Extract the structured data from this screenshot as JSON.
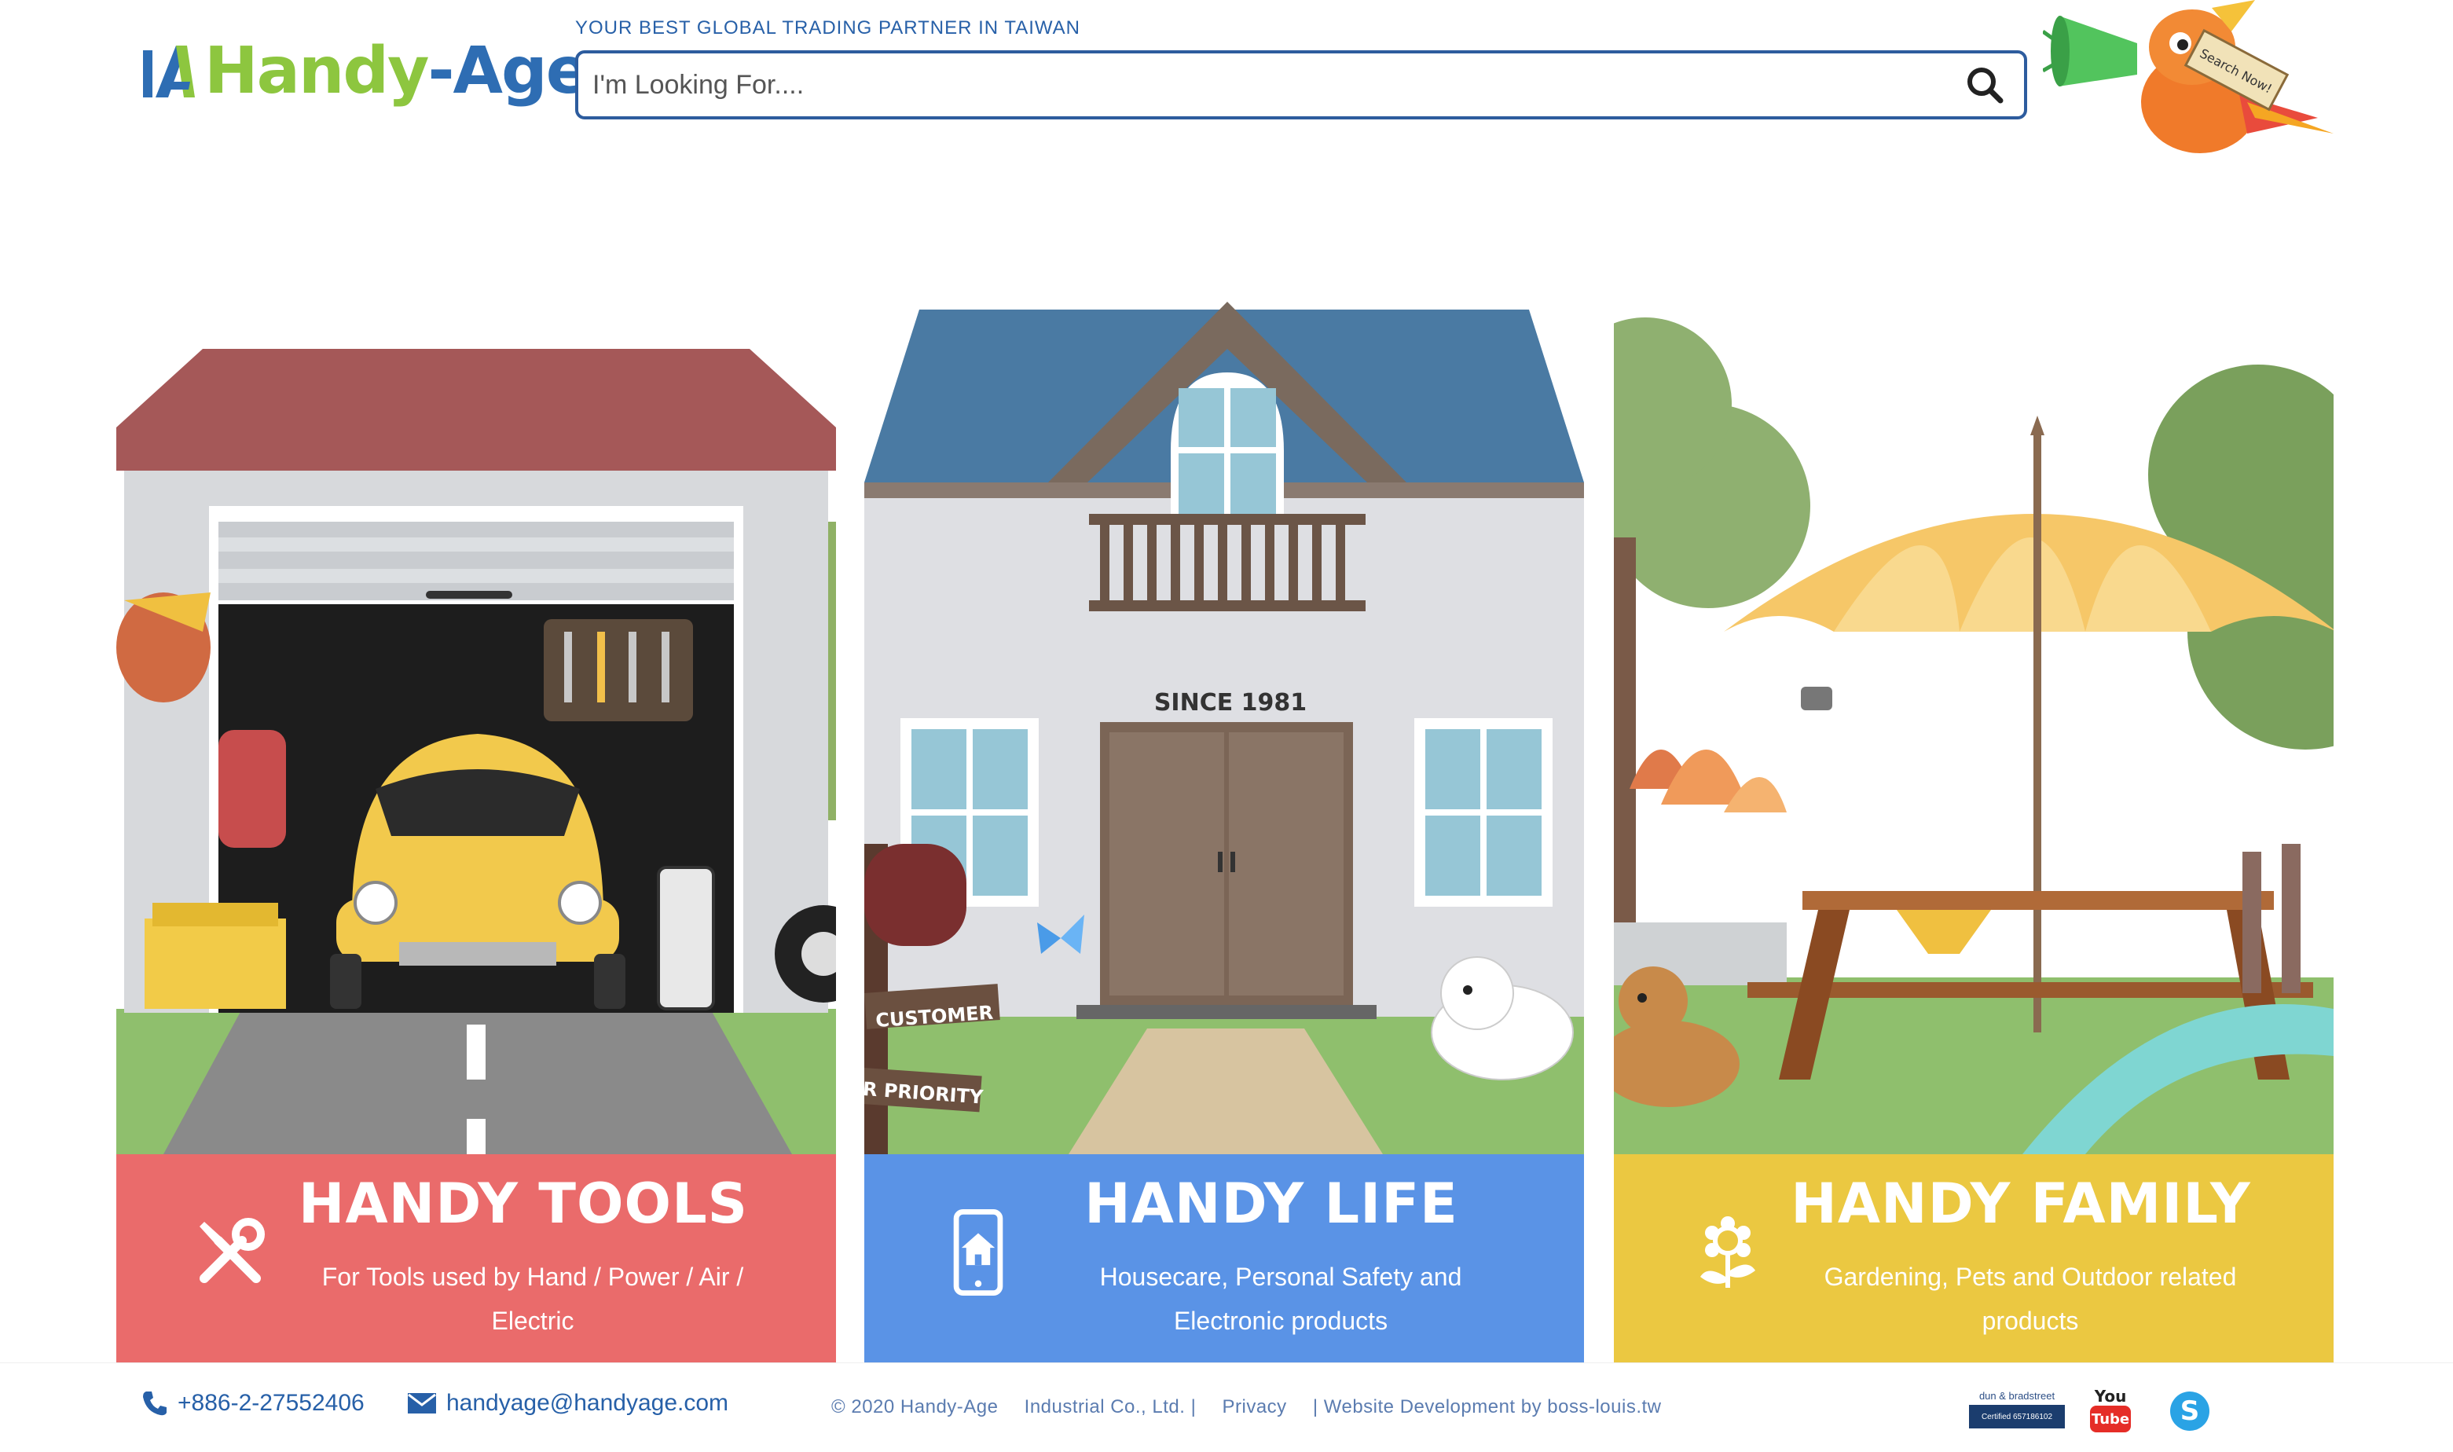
{
  "header": {
    "logo_text_part1": "Handy",
    "logo_text_part2": "-Age",
    "tagline": "YOUR BEST GLOBAL TRADING PARTNER IN TAIWAN",
    "search_placeholder": "I'm Looking For....",
    "mascot_sign": "Search Now!"
  },
  "panels": [
    {
      "title": "HANDY TOOLS",
      "description": "For Tools used by Hand / Power / Air / Electric",
      "icon": "tools-icon",
      "color": "#ea6b6b"
    },
    {
      "title": "HANDY LIFE",
      "description": "Housecare, Personal Safety and Electronic products",
      "icon": "smartphone-home-icon",
      "color": "#5a93e6",
      "scene_text": {
        "since": "SINCE 1981",
        "sign1": "CUSTOMER",
        "sign2": "R PRIORITY"
      }
    },
    {
      "title": "HANDY FAMILY",
      "description": "Gardening, Pets and Outdoor related products",
      "icon": "flower-icon",
      "color": "#ebc841"
    }
  ],
  "footer": {
    "phone": "+886-2-27552406",
    "email": "handyage@handyage.com",
    "copyright": "© 2020 Handy-Age",
    "company": "Industrial Co., Ltd. |",
    "privacy": "Privacy",
    "dev_credit": "| Website Development by boss-louis.tw",
    "dnb_top": "dun & bradstreet",
    "dnb_bottom": "Certified 657186102",
    "youtube_top": "You",
    "youtube_bottom": "Tube"
  }
}
